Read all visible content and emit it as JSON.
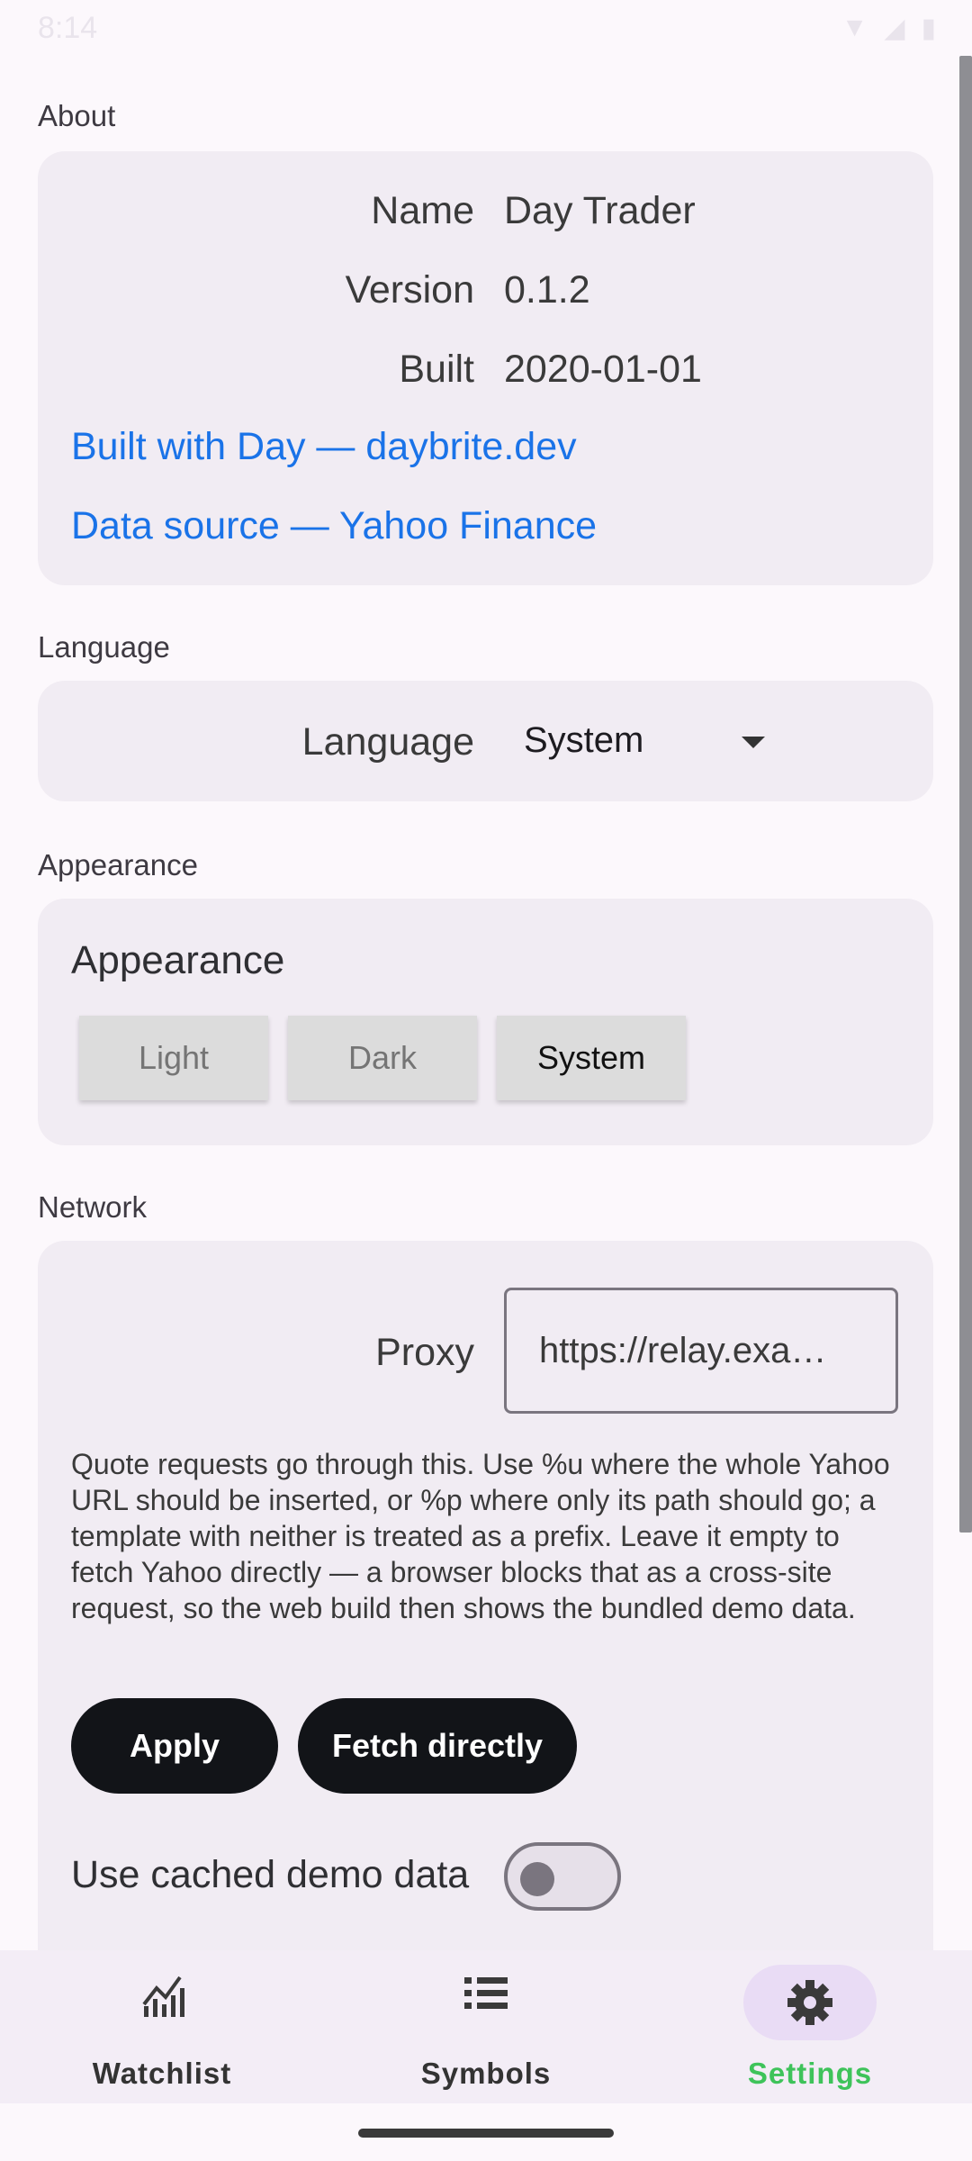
{
  "status_bar": {
    "time": "8:14"
  },
  "about": {
    "section_title": "About",
    "rows": [
      {
        "key": "Name",
        "value": "Day Trader"
      },
      {
        "key": "Version",
        "value": "0.1.2"
      },
      {
        "key": "Built",
        "value": "2020-01-01"
      }
    ],
    "links": [
      "Built with Day — daybrite.dev",
      "Data source — Yahoo Finance"
    ]
  },
  "language": {
    "section_title": "Language",
    "label": "Language",
    "selected": "System"
  },
  "appearance": {
    "section_title": "Appearance",
    "heading": "Appearance",
    "options": [
      "Light",
      "Dark",
      "System"
    ],
    "selected": "System"
  },
  "network": {
    "section_title": "Network",
    "proxy_label": "Proxy",
    "proxy_value": "https://relay.exa…",
    "help_text": "Quote requests go through this. Use %u where the whole Yahoo URL should be inserted, or %p where only its path should go; a template with neither is treated as a prefix. Leave it empty to fetch Yahoo directly — a browser blocks that as a cross-site request, so the web build then shows the bundled demo data.",
    "apply_label": "Apply",
    "fetch_direct_label": "Fetch directly",
    "cached_demo_label": "Use cached demo data",
    "cached_demo_enabled": false
  },
  "bottom_nav": {
    "items": [
      {
        "label": "Watchlist",
        "icon": "chart-icon"
      },
      {
        "label": "Symbols",
        "icon": "list-icon"
      },
      {
        "label": "Settings",
        "icon": "gear-icon"
      }
    ],
    "active": "Settings"
  },
  "colors": {
    "link": "#1a73e8",
    "active_nav": "#3ec35a",
    "primary_button": "#121418"
  }
}
